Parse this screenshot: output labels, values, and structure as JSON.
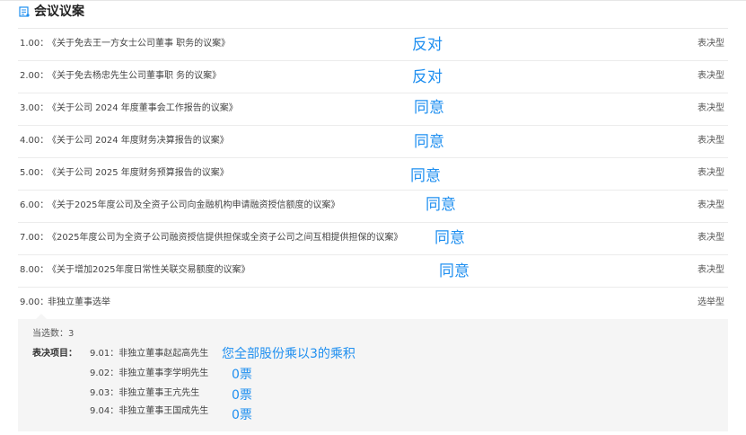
{
  "header": {
    "title": "会议议案",
    "icon": "document-list-icon",
    "accent": "#1f8ff0"
  },
  "proposals": [
    {
      "num": "1.00：",
      "title": "《关于免去王一方女士公司董事 职务的议案》",
      "type": "表决型",
      "vote": "反对"
    },
    {
      "num": "2.00：",
      "title": "《关于免去杨忠先生公司董事职 务的议案》",
      "type": "表决型",
      "vote": "反对"
    },
    {
      "num": "3.00：",
      "title": "《关于公司 2024 年度董事会工作报告的议案》",
      "type": "表决型",
      "vote": "同意"
    },
    {
      "num": "4.00：",
      "title": "《关于公司 2024 年度财务决算报告的议案》",
      "type": "表决型",
      "vote": "同意"
    },
    {
      "num": "5.00：",
      "title": "《关于公司 2025 年度财务预算报告的议案》",
      "type": "表决型",
      "vote": "同意"
    },
    {
      "num": "6.00：",
      "title": "《关于2025年度公司及全资子公司向金融机构申请融资授信额度的议案》",
      "type": "表决型",
      "vote": "同意"
    },
    {
      "num": "7.00：",
      "title": "《2025年度公司为全资子公司融资授信提供担保或全资子公司之间互相提供担保的议案》",
      "type": "表决型",
      "vote": "同意"
    },
    {
      "num": "8.00：",
      "title": "《关于增加2025年度日常性关联交易额度的议案》",
      "type": "表决型",
      "vote": "同意"
    },
    {
      "num": "9.00：",
      "title": "非独立董事选举",
      "type": "选举型",
      "vote": ""
    }
  ],
  "election": {
    "count_label": "当选数：3",
    "items_label": "表决项目：",
    "candidates": [
      {
        "label": "9.01：非独立董事赵起高先生",
        "vote": "您全部股份乘以3的乘积"
      },
      {
        "label": "9.02：非独立董事李学明先生",
        "vote": "0票"
      },
      {
        "label": "9.03：非独立董事王亢先生",
        "vote": "0票"
      },
      {
        "label": "9.04：非独立董事王国成先生",
        "vote": "0票"
      }
    ]
  }
}
